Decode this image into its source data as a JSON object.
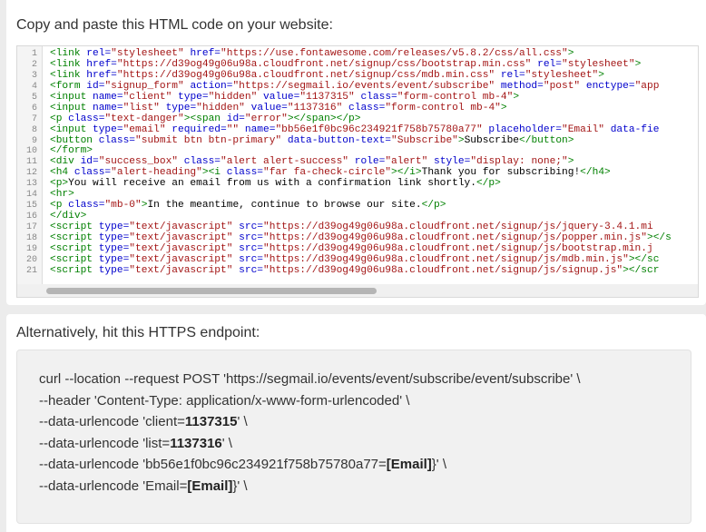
{
  "html_section": {
    "title": "Copy and paste this HTML code on your website:",
    "lines": [
      {
        "n": "1",
        "parts": [
          [
            "tg",
            "<link "
          ],
          [
            "at",
            "rel="
          ],
          [
            "st",
            "\"stylesheet\""
          ],
          [
            "at",
            " href="
          ],
          [
            "st",
            "\"https://use.fontawesome.com/releases/v5.8.2/css/all.css\""
          ],
          [
            "tg",
            ">"
          ]
        ]
      },
      {
        "n": "2",
        "parts": [
          [
            "tg",
            "<link "
          ],
          [
            "at",
            "href="
          ],
          [
            "st",
            "\"https://d39og49g06u98a.cloudfront.net/signup/css/bootstrap.min.css\""
          ],
          [
            "at",
            " rel="
          ],
          [
            "st",
            "\"stylesheet\""
          ],
          [
            "tg",
            ">"
          ]
        ]
      },
      {
        "n": "3",
        "parts": [
          [
            "tg",
            "<link "
          ],
          [
            "at",
            "href="
          ],
          [
            "st",
            "\"https://d39og49g06u98a.cloudfront.net/signup/css/mdb.min.css\""
          ],
          [
            "at",
            " rel="
          ],
          [
            "st",
            "\"stylesheet\""
          ],
          [
            "tg",
            ">"
          ]
        ]
      },
      {
        "n": "4",
        "parts": [
          [
            "tg",
            "<form "
          ],
          [
            "at",
            "id="
          ],
          [
            "st",
            "\"signup_form\""
          ],
          [
            "at",
            " action="
          ],
          [
            "st",
            "\"https://segmail.io/events/event/subscribe\""
          ],
          [
            "at",
            " method="
          ],
          [
            "st",
            "\"post\""
          ],
          [
            "at",
            " enctype="
          ],
          [
            "st",
            "\"app"
          ]
        ]
      },
      {
        "n": "5",
        "parts": [
          [
            "tg",
            "<input "
          ],
          [
            "at",
            "name="
          ],
          [
            "st",
            "\"client\""
          ],
          [
            "at",
            " type="
          ],
          [
            "st",
            "\"hidden\""
          ],
          [
            "at",
            " value="
          ],
          [
            "st",
            "\"1137315\""
          ],
          [
            "at",
            " class="
          ],
          [
            "st",
            "\"form-control mb-4\""
          ],
          [
            "tg",
            ">"
          ]
        ]
      },
      {
        "n": "6",
        "parts": [
          [
            "tg",
            "<input "
          ],
          [
            "at",
            "name="
          ],
          [
            "st",
            "\"list\""
          ],
          [
            "at",
            " type="
          ],
          [
            "st",
            "\"hidden\""
          ],
          [
            "at",
            " value="
          ],
          [
            "st",
            "\"1137316\""
          ],
          [
            "at",
            " class="
          ],
          [
            "st",
            "\"form-control mb-4\""
          ],
          [
            "tg",
            ">"
          ]
        ]
      },
      {
        "n": "7",
        "parts": [
          [
            "tg",
            "<p "
          ],
          [
            "at",
            "class="
          ],
          [
            "st",
            "\"text-danger\""
          ],
          [
            "tg",
            "><span "
          ],
          [
            "at",
            "id="
          ],
          [
            "st",
            "\"error\""
          ],
          [
            "tg",
            "></span></p>"
          ]
        ]
      },
      {
        "n": "8",
        "parts": [
          [
            "tg",
            "<input "
          ],
          [
            "at",
            "type="
          ],
          [
            "st",
            "\"email\""
          ],
          [
            "at",
            " required="
          ],
          [
            "st",
            "\"\""
          ],
          [
            "at",
            " name="
          ],
          [
            "st",
            "\"bb56e1f0bc96c234921f758b75780a77\""
          ],
          [
            "at",
            " placeholder="
          ],
          [
            "st",
            "\"Email\""
          ],
          [
            "at",
            " data-fie"
          ]
        ]
      },
      {
        "n": "9",
        "parts": [
          [
            "tg",
            "<button "
          ],
          [
            "at",
            "class="
          ],
          [
            "st",
            "\"submit btn btn-primary\""
          ],
          [
            "at",
            " data-button-text="
          ],
          [
            "st",
            "\"Subscribe\""
          ],
          [
            "tg",
            ">"
          ],
          [
            "tx",
            "Subscribe"
          ],
          [
            "tg",
            "</button>"
          ]
        ]
      },
      {
        "n": "10",
        "parts": [
          [
            "tg",
            "</form>"
          ]
        ]
      },
      {
        "n": "11",
        "parts": [
          [
            "tg",
            "<div "
          ],
          [
            "at",
            "id="
          ],
          [
            "st",
            "\"success_box\""
          ],
          [
            "at",
            " class="
          ],
          [
            "st",
            "\"alert alert-success\""
          ],
          [
            "at",
            " role="
          ],
          [
            "st",
            "\"alert\""
          ],
          [
            "at",
            " style="
          ],
          [
            "st",
            "\"display: none;\""
          ],
          [
            "tg",
            ">"
          ]
        ]
      },
      {
        "n": "12",
        "parts": [
          [
            "tg",
            "<h4 "
          ],
          [
            "at",
            "class="
          ],
          [
            "st",
            "\"alert-heading\""
          ],
          [
            "tg",
            "><i "
          ],
          [
            "at",
            "class="
          ],
          [
            "st",
            "\"far fa-check-circle\""
          ],
          [
            "tg",
            "></i>"
          ],
          [
            "tx",
            "Thank you for subscribing!"
          ],
          [
            "tg",
            "</h4>"
          ]
        ]
      },
      {
        "n": "13",
        "parts": [
          [
            "tg",
            "<p>"
          ],
          [
            "tx",
            "You will receive an email from us with a confirmation link shortly."
          ],
          [
            "tg",
            "</p>"
          ]
        ]
      },
      {
        "n": "14",
        "parts": [
          [
            "tg",
            "<hr>"
          ]
        ]
      },
      {
        "n": "15",
        "parts": [
          [
            "tg",
            "<p "
          ],
          [
            "at",
            "class="
          ],
          [
            "st",
            "\"mb-0\""
          ],
          [
            "tg",
            ">"
          ],
          [
            "tx",
            "In the meantime, continue to browse our site."
          ],
          [
            "tg",
            "</p>"
          ]
        ]
      },
      {
        "n": "16",
        "parts": [
          [
            "tg",
            "</div>"
          ]
        ]
      },
      {
        "n": "17",
        "parts": [
          [
            "tg",
            "<script "
          ],
          [
            "at",
            "type="
          ],
          [
            "st",
            "\"text/javascript\""
          ],
          [
            "at",
            " src="
          ],
          [
            "st",
            "\"https://d39og49g06u98a.cloudfront.net/signup/js/jquery-3.4.1.mi"
          ]
        ]
      },
      {
        "n": "18",
        "parts": [
          [
            "tg",
            "<script "
          ],
          [
            "at",
            "type="
          ],
          [
            "st",
            "\"text/javascript\""
          ],
          [
            "at",
            " src="
          ],
          [
            "st",
            "\"https://d39og49g06u98a.cloudfront.net/signup/js/popper.min.js\""
          ],
          [
            "tg",
            "></s"
          ]
        ]
      },
      {
        "n": "19",
        "parts": [
          [
            "tg",
            "<script "
          ],
          [
            "at",
            "type="
          ],
          [
            "st",
            "\"text/javascript\""
          ],
          [
            "at",
            " src="
          ],
          [
            "st",
            "\"https://d39og49g06u98a.cloudfront.net/signup/js/bootstrap.min.j"
          ]
        ]
      },
      {
        "n": "20",
        "parts": [
          [
            "tg",
            "<script "
          ],
          [
            "at",
            "type="
          ],
          [
            "st",
            "\"text/javascript\""
          ],
          [
            "at",
            " src="
          ],
          [
            "st",
            "\"https://d39og49g06u98a.cloudfront.net/signup/js/mdb.min.js\""
          ],
          [
            "tg",
            "></sc"
          ]
        ]
      },
      {
        "n": "21",
        "parts": [
          [
            "tg",
            "<script "
          ],
          [
            "at",
            "type="
          ],
          [
            "st",
            "\"text/javascript\""
          ],
          [
            "at",
            " src="
          ],
          [
            "st",
            "\"https://d39og49g06u98a.cloudfront.net/signup/js/signup.js\""
          ],
          [
            "tg",
            "></scr"
          ]
        ]
      }
    ]
  },
  "endpoint_section": {
    "title": "Alternatively, hit this HTTPS endpoint:",
    "lines": [
      [
        [
          "n",
          "curl --location --request POST 'https://segmail.io/events/event/subscribe/event/subscribe' \\"
        ]
      ],
      [
        [
          "n",
          "--header 'Content-Type: application/x-www-form-urlencoded' \\"
        ]
      ],
      [
        [
          "n",
          "--data-urlencode 'client="
        ],
        [
          "b",
          "1137315"
        ],
        [
          "n",
          "' \\"
        ]
      ],
      [
        [
          "n",
          "--data-urlencode 'list="
        ],
        [
          "b",
          "1137316"
        ],
        [
          "n",
          "' \\"
        ]
      ],
      [
        [
          "n",
          "--data-urlencode 'bb56e1f0bc96c234921f758b75780a77="
        ],
        [
          "b",
          "[Email]"
        ],
        [
          "n",
          "}' \\"
        ]
      ],
      [
        [
          "n",
          "--data-urlencode 'Email="
        ],
        [
          "b",
          "[Email]"
        ],
        [
          "n",
          "}' \\"
        ]
      ]
    ]
  }
}
